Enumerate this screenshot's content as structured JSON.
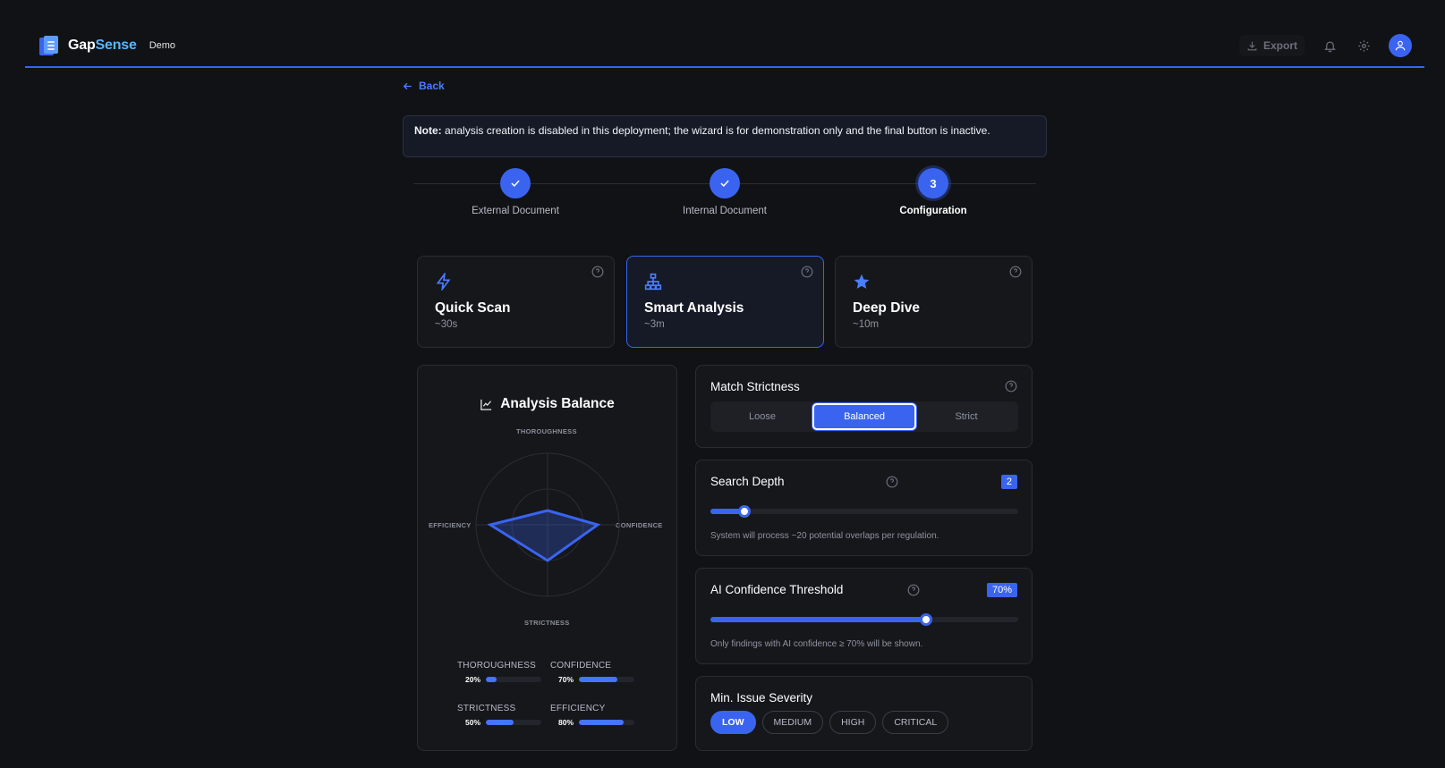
{
  "header": {
    "brand_part1": "Gap",
    "brand_part2": "Sense",
    "brand_tag": "Demo",
    "export_label": "Export",
    "icons": [
      "download-icon",
      "bell-icon",
      "gear-icon",
      "user-icon"
    ]
  },
  "nav": {
    "back_label": "Back"
  },
  "note": {
    "prefix": "Note:",
    "text": " analysis creation is disabled in this deployment; the wizard is for demonstration only and the final button is inactive."
  },
  "stepper": {
    "steps": [
      {
        "label": "External Document",
        "state": "done"
      },
      {
        "label": "Internal Document",
        "state": "done"
      },
      {
        "label": "Configuration",
        "state": "active",
        "number": "3"
      }
    ]
  },
  "modes": [
    {
      "title": "Quick Scan",
      "time": "~30s",
      "icon": "bolt-icon",
      "selected": false
    },
    {
      "title": "Smart Analysis",
      "time": "~3m",
      "icon": "hierarchy-icon",
      "selected": true
    },
    {
      "title": "Deep Dive",
      "time": "~10m",
      "icon": "star-icon",
      "selected": false
    }
  ],
  "balance": {
    "title": "Analysis Balance",
    "axes": {
      "top": "THOROUGHNESS",
      "right": "CONFIDENCE",
      "bottom": "STRICTNESS",
      "left": "EFFICIENCY"
    },
    "metrics": [
      {
        "name": "THOROUGHNESS",
        "value_label": "20%",
        "value": 0.2
      },
      {
        "name": "CONFIDENCE",
        "value_label": "70%",
        "value": 0.7
      },
      {
        "name": "STRICTNESS",
        "value_label": "50%",
        "value": 0.5
      },
      {
        "name": "EFFICIENCY",
        "value_label": "80%",
        "value": 0.8
      }
    ]
  },
  "match_strictness": {
    "title": "Match Strictness",
    "options": [
      "Loose",
      "Balanced",
      "Strict"
    ],
    "selected": "Balanced"
  },
  "search_depth": {
    "title": "Search Depth",
    "value": "2",
    "fraction": 0.11,
    "hint": "System will process ~20 potential overlaps per regulation."
  },
  "confidence_threshold": {
    "title": "AI Confidence Threshold",
    "value": "70%",
    "fraction": 0.7,
    "hint": "Only findings with AI confidence ≥ 70% will be shown."
  },
  "severity": {
    "title": "Min. Issue Severity",
    "options": [
      "LOW",
      "MEDIUM",
      "HIGH",
      "CRITICAL"
    ],
    "selected": "LOW"
  },
  "colors": {
    "accent": "#3a64f0",
    "background": "#111215",
    "panel": "#16171b"
  }
}
